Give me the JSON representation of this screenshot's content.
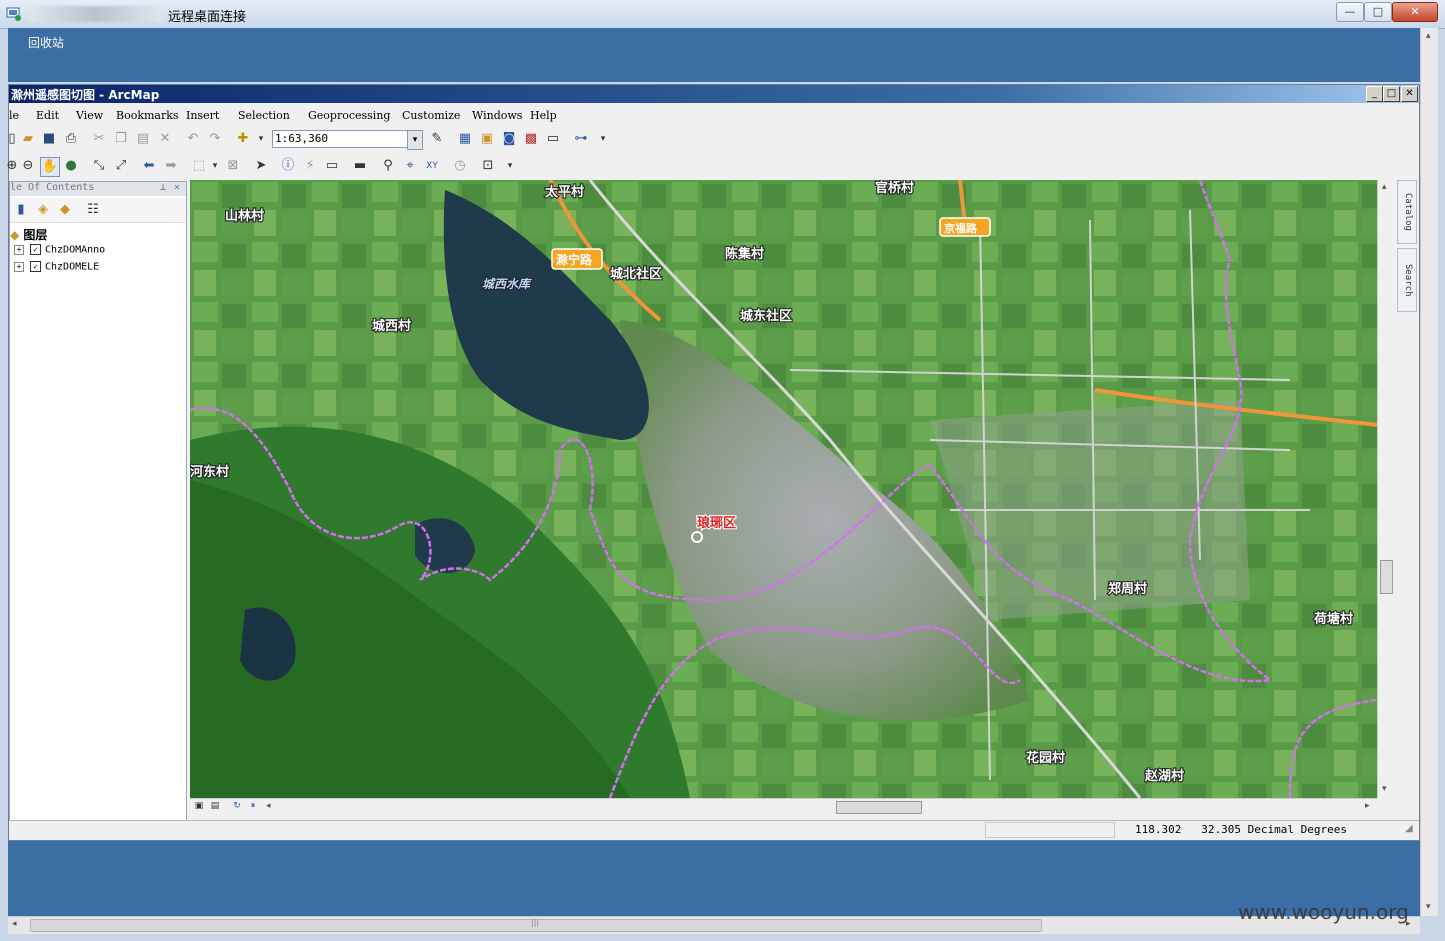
{
  "rdp": {
    "title": "远程桌面连接",
    "buttons": {
      "minimize": "—",
      "maximize": "□",
      "close": "✕"
    },
    "desktop_icon_label": "回收站",
    "scroll_left": "◂",
    "scroll_right": "▸",
    "scroll_up": "▴",
    "scroll_down": "▾",
    "scroll_grip": "|||"
  },
  "watermark": "www.wooyun.org",
  "arcmap": {
    "title": "滁州遥感图切图 - ArcMap",
    "window_buttons": {
      "minimize": "_",
      "maximize": "□",
      "close": "✕"
    },
    "menu": [
      "le",
      "Edit",
      "View",
      "Bookmarks",
      "Insert",
      "Selection",
      "Geoprocessing",
      "Customize",
      "Windows",
      "Help"
    ],
    "scale": "1:63,360",
    "toc": {
      "title": "le Of Contents",
      "group_label": "图层",
      "layers": [
        {
          "name": "ChzDOMAnno",
          "checked": true
        },
        {
          "name": "ChzDOMELE",
          "checked": true
        }
      ]
    },
    "dock_tabs": [
      "Catalog",
      "Search"
    ],
    "status": {
      "x": "118.302",
      "y": "32.305",
      "units": "Decimal Degrees"
    },
    "map_labels": [
      {
        "id": "taiping",
        "text": "太平村"
      },
      {
        "id": "shanhou",
        "text": "山林村"
      },
      {
        "id": "chengxi-reservoir",
        "text": "城西水库"
      },
      {
        "id": "chengbei",
        "text": "城北社区"
      },
      {
        "id": "chenji",
        "text": "陈集村"
      },
      {
        "id": "chengdong",
        "text": "城东社区"
      },
      {
        "id": "chengxi-village",
        "text": "城西村"
      },
      {
        "id": "hedong",
        "text": "河东村"
      },
      {
        "id": "langya",
        "text": "琅琊区"
      },
      {
        "id": "xinwei",
        "text": "郑周村"
      },
      {
        "id": "heli",
        "text": "荷塘村"
      },
      {
        "id": "huayuan",
        "text": "花园村"
      },
      {
        "id": "zhaozhuang",
        "text": "赵湖村"
      },
      {
        "id": "guanzhuang",
        "text": "官桥村"
      }
    ],
    "road_labels": [
      {
        "id": "chuning",
        "text": "滁宁路"
      },
      {
        "id": "northroad",
        "text": "京福路"
      }
    ]
  },
  "colors": {
    "desktop": "#3a6ea5",
    "terrain_dark": "#2f7a2c",
    "terrain_light": "#5aa04a",
    "urban": "#a9aeb1",
    "water": "#1f3a4a",
    "boundary": "#d36ff0",
    "road": "#f0953a"
  }
}
